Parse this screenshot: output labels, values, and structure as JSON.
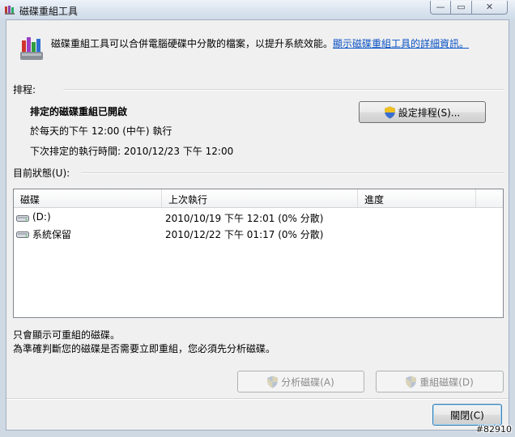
{
  "window": {
    "title": "磁碟重組工具",
    "min_glyph": "—",
    "max_glyph": "▭",
    "close_glyph": "✕"
  },
  "intro": {
    "text": "磁碟重組工具可以合併電腦硬碟中分散的檔案，以提升系統效能。",
    "link": "顯示磁碟重組工具的詳細資訊。"
  },
  "schedule": {
    "section_label": "排程:",
    "status": "排定的磁碟重組已開啟",
    "run_time": "於每天的下午 12:00 (中午) 執行",
    "next_run": "下次排定的執行時間: 2010/12/23 下午 12:00",
    "configure_button": "設定排程(S)..."
  },
  "current_status": {
    "section_label": "目前狀態(U):",
    "columns": [
      "磁碟",
      "上次執行",
      "進度"
    ],
    "rows": [
      {
        "disk": "(D:)",
        "last_run": "2010/10/19 下午 12:01 (0% 分散)",
        "progress": ""
      },
      {
        "disk": "系統保留",
        "last_run": "2010/12/22 下午 01:17 (0% 分散)",
        "progress": ""
      }
    ]
  },
  "notes": {
    "line1": "只會顯示可重組的磁碟。",
    "line2": "為準確判斷您的磁碟是否需要立即重組，您必須先分析磁碟。"
  },
  "actions": {
    "analyze_button": "分析磁碟(A)",
    "defrag_button": "重組磁碟(D)",
    "close_button": "關閉(C)"
  },
  "watermark": "#82910",
  "icons": {
    "app": "defrag-icon",
    "shield": "uac-shield-icon",
    "drive": "hard-drive-icon"
  }
}
